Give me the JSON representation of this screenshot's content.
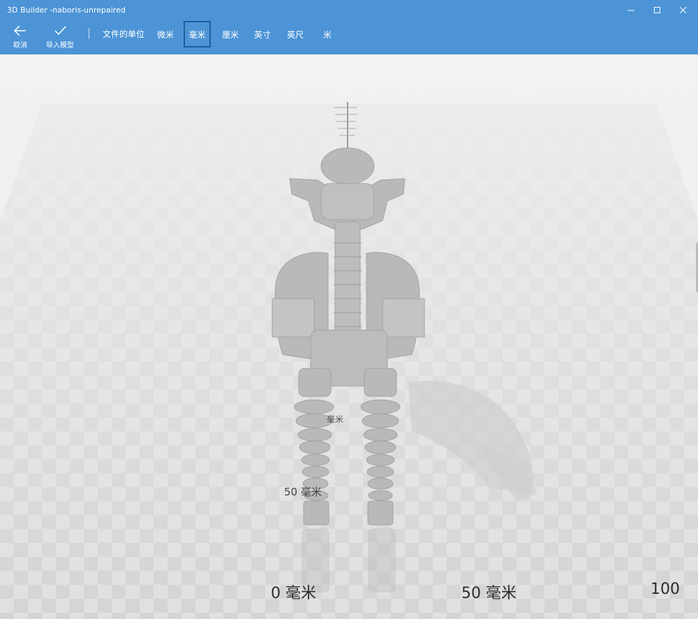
{
  "window": {
    "title": "3D Builder -naboris-unrepaired",
    "controls": [
      "minimize-icon",
      "maximize-icon",
      "close-icon"
    ]
  },
  "toolbar": {
    "cancel_label": "取消",
    "cancel_icon": "back-arrow-icon",
    "import_label": "导入模型",
    "import_icon": "checkmark-icon",
    "units_caption": "文件的单位",
    "units": [
      "微米",
      "毫米",
      "厘米",
      "英寸",
      "英尺",
      "米"
    ],
    "selected_unit": "毫米"
  },
  "viewport": {
    "ruler_labels": {
      "front_left": "0 毫米",
      "front_mid": "50 毫米",
      "front_right": "100",
      "mid": "50 毫米",
      "back": "毫米"
    }
  },
  "colors": {
    "accent": "#4c94d6",
    "selected_border": "#1e5fa0",
    "floor": "#dcdcdc",
    "model": "#b7b7b7"
  }
}
